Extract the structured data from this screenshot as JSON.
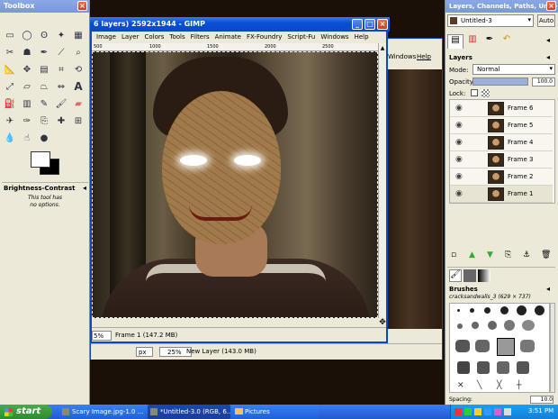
{
  "toolbox": {
    "title": "Toolbox",
    "options_title": "Brightness-Contrast",
    "options_text_1": "This tool has",
    "options_text_2": "no options."
  },
  "image_window": {
    "title": "6 layers) 2592x1944 - GIMP",
    "menu": [
      "Image",
      "Layer",
      "Colors",
      "Tools",
      "Filters",
      "Animate",
      "FX-Foundry",
      "Script-Fu",
      "Windows",
      "Help"
    ],
    "ruler_marks": [
      "500",
      "1000",
      "1500",
      "2000",
      "2500"
    ],
    "zoom": "5%",
    "status": "Frame 1 (147.2 MB)"
  },
  "back_window": {
    "menu": [
      "Windows",
      "Help"
    ],
    "unit": "px",
    "zoom": "25%",
    "status": "New Layer (143.0 MB)"
  },
  "layers_dock": {
    "title": "Layers, Channels, Paths, Undo - ...",
    "image_select": "Untitled-3",
    "auto_label": "Auto",
    "layers_label": "Layers",
    "mode_label": "Mode:",
    "mode_value": "Normal",
    "opacity_label": "Opacity:",
    "opacity_value": "100.0",
    "opacity_fraction": 1.0,
    "lock_label": "Lock:",
    "layers": [
      {
        "name": "Frame 6",
        "selected": false
      },
      {
        "name": "Frame 5",
        "selected": false
      },
      {
        "name": "Frame 4",
        "selected": false
      },
      {
        "name": "Frame 3",
        "selected": false
      },
      {
        "name": "Frame 2",
        "selected": false
      },
      {
        "name": "Frame 1",
        "selected": true
      }
    ],
    "brushes_label": "Brushes",
    "brush_name": "cracksandwalls_3 (629 × 737)",
    "spacing_label": "Spacing:",
    "spacing_value": "10.0"
  },
  "taskbar": {
    "start": "start",
    "items": [
      "Scary Image.jpg-1.0 ...",
      "*Untitled-3.0 (RGB, 6...",
      "Pictures"
    ],
    "clock": "3:51 PM"
  },
  "colors": {
    "xp_blue": "#0a4fd6",
    "taskbar_blue": "#2060d8",
    "start_green": "#3c9a3c",
    "panel": "#ece9d8"
  }
}
